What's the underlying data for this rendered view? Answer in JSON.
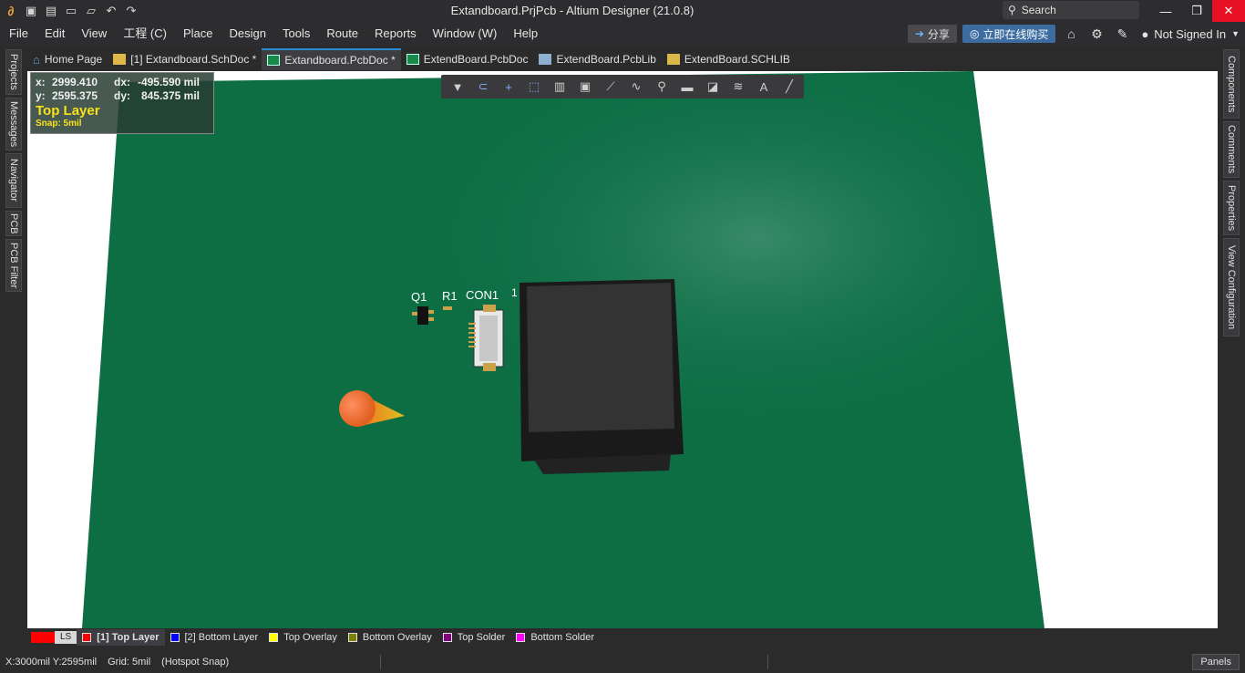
{
  "window": {
    "title": "Extandboard.PrjPcb - Altium Designer (21.0.8)",
    "search_placeholder": "Search"
  },
  "menu": {
    "items": [
      "File",
      "Edit",
      "View",
      "工程 (C)",
      "Place",
      "Design",
      "Tools",
      "Route",
      "Reports",
      "Window (W)",
      "Help"
    ],
    "share_label": "分享",
    "buy_label": "立即在线购买",
    "signin_label": "Not Signed In"
  },
  "left_panels": [
    "Projects",
    "Messages",
    "Navigator",
    "PCB",
    "PCB Filter"
  ],
  "right_panels": [
    "Components",
    "Comments",
    "Properties",
    "View Configuration"
  ],
  "doc_tabs": [
    {
      "label": "Home Page",
      "active": false
    },
    {
      "label": "[1] Extandboard.SchDoc *",
      "active": false
    },
    {
      "label": "Extandboard.PcbDoc *",
      "active": true
    },
    {
      "label": "ExtendBoard.PcbDoc",
      "active": false
    },
    {
      "label": "ExtendBoard.PcbLib",
      "active": false
    },
    {
      "label": "ExtendBoard.SCHLIB",
      "active": false
    }
  ],
  "hud": {
    "x_label": "x:",
    "x_value": "2999.410",
    "dx_label": "dx:",
    "dx_value": "-495.590 mil",
    "y_label": "y:",
    "y_value": "2595.375",
    "dy_label": "dy:",
    "dy_value": "845.375 mil",
    "layer": "Top Layer",
    "snap": "Snap: 5mil"
  },
  "designators": {
    "q1": "Q1",
    "r1": "R1",
    "con1": "CON1",
    "pin1": "1"
  },
  "layers": {
    "ls_label": "LS",
    "tabs": [
      {
        "label": "[1] Top Layer",
        "color": "#ff0000",
        "active": true
      },
      {
        "label": "[2] Bottom Layer",
        "color": "#0000ff",
        "active": false
      },
      {
        "label": "Top Overlay",
        "color": "#ffff00",
        "active": false
      },
      {
        "label": "Bottom Overlay",
        "color": "#808000",
        "active": false
      },
      {
        "label": "Top Solder",
        "color": "#800080",
        "active": false
      },
      {
        "label": "Bottom Solder",
        "color": "#ff00ff",
        "active": false
      }
    ]
  },
  "status": {
    "position": "X:3000mil Y:2595mil",
    "grid": "Grid: 5mil",
    "snap_mode": "(Hotspot Snap)",
    "panels_label": "Panels"
  },
  "colors": {
    "board": "#0d6e44",
    "accent": "#2a8ad4",
    "close": "#e81123"
  }
}
